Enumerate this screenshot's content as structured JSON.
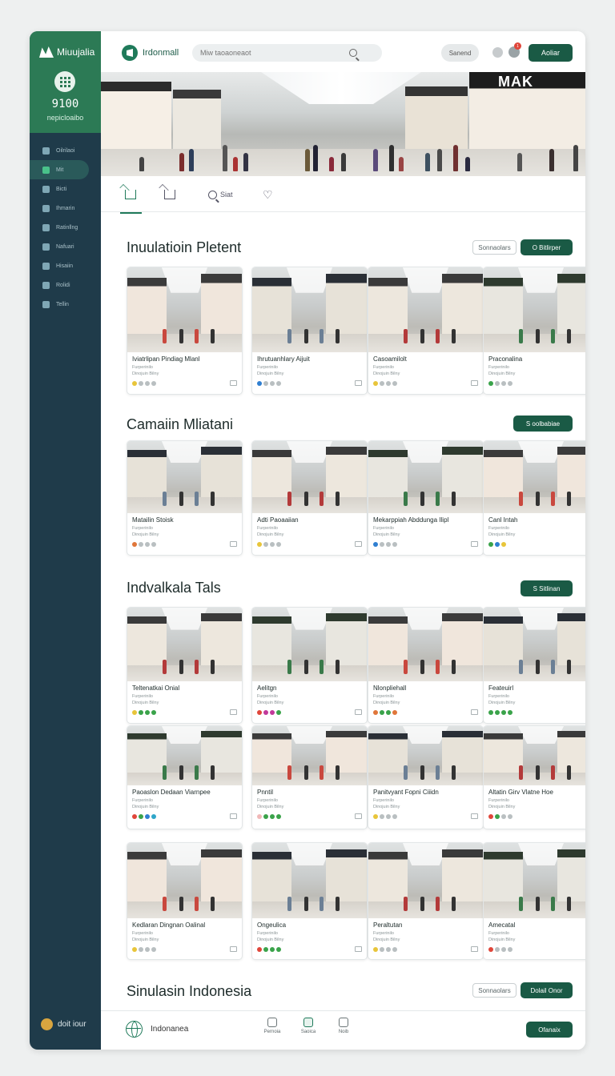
{
  "sidebar": {
    "brand": "Miuujalia",
    "stat_value": "9100",
    "stat_label": "nepicloaibo",
    "items": [
      {
        "label": "Oilrilaoi",
        "active": false
      },
      {
        "label": "Mit",
        "active": true
      },
      {
        "label": "Bicti",
        "active": false
      },
      {
        "label": "Ihmarin",
        "active": false
      },
      {
        "label": "Ratinllng",
        "active": false
      },
      {
        "label": "Nafuari",
        "active": false
      },
      {
        "label": "Hisaiin",
        "active": false
      },
      {
        "label": "Rolidi",
        "active": false
      },
      {
        "label": "Tellin",
        "active": false
      }
    ],
    "footer": "doit iour"
  },
  "header": {
    "logo": "Irdonmall",
    "search_placeholder": "Miw taoaoneaot",
    "secondary_button": "Sanend",
    "badge": "1",
    "primary_button": "Aoliar"
  },
  "hero": {
    "sign": "MAK"
  },
  "tabs": [
    {
      "label": "",
      "icon": "home-icon",
      "active": true
    },
    {
      "label": "",
      "icon": "home-icon",
      "active": false
    },
    {
      "label": "Siat",
      "icon": "search-icon",
      "active": false
    },
    {
      "label": "",
      "icon": "heart-icon",
      "active": false
    }
  ],
  "sections": [
    {
      "title": "Inuulatioin Pletent",
      "outline_button": "Sonnaolars",
      "green_button": "O Bitlirper",
      "cards": [
        {
          "title": "Iviatrlipan Pindiag Mlanl",
          "meta1": "Furperinilo",
          "meta2": "Dinojuin Bilny",
          "dots": [
            "#e8c53a",
            "#b9bfc1",
            "#b9bfc1",
            "#b9bfc1"
          ]
        },
        {
          "title": "Ihrutuanhlary Aijuit",
          "meta1": "Furperinilo",
          "meta2": "Dinojuin Bilny",
          "dots": [
            "#2f7fd1",
            "#b9bfc1",
            "#b9bfc1",
            "#b9bfc1"
          ]
        },
        {
          "title": "Casoamilolt",
          "meta1": "Furperinilo",
          "meta2": "Dinojuin Bilny",
          "dots": [
            "#e8c53a",
            "#b9bfc1",
            "#b9bfc1",
            "#b9bfc1"
          ]
        },
        {
          "title": "Praconalina",
          "meta1": "Furperinilo",
          "meta2": "Dinojuin Bilny",
          "dots": [
            "#3aa34a",
            "#b9bfc1",
            "#b9bfc1",
            "#b9bfc1"
          ]
        }
      ]
    },
    {
      "title": "Camaiin Mliatani",
      "outline_button": "",
      "green_button": "S oolbabiae",
      "cards": [
        {
          "title": "Matailin Stoisk",
          "meta1": "Furperinilo",
          "meta2": "Dinojuin Bilny",
          "dots": [
            "#e0763a",
            "#b9bfc1",
            "#b9bfc1",
            "#b9bfc1"
          ]
        },
        {
          "title": "Adti Paoaaiian",
          "meta1": "Furperinilo",
          "meta2": "Dinojuin Bilny",
          "dots": [
            "#e8c53a",
            "#b9bfc1",
            "#b9bfc1",
            "#b9bfc1"
          ]
        },
        {
          "title": "Mekarppiah Abddunga Ilipl",
          "meta1": "Furperinilo",
          "meta2": "Dinojuin Bilny",
          "dots": [
            "#2f7fd1",
            "#b9bfc1",
            "#b9bfc1",
            "#b9bfc1"
          ]
        },
        {
          "title": "Canl Intah",
          "meta1": "Furperinilo",
          "meta2": "Dinojuin Bilny",
          "dots": [
            "#3aa34a",
            "#2f7fd1",
            "#e8c53a"
          ]
        }
      ]
    },
    {
      "title": "Indvalkala Tals",
      "outline_button": "",
      "green_button": "S Sitlinan",
      "cards": [
        {
          "title": "Teltenatkai Onial",
          "meta1": "Furperinilo",
          "meta2": "Dinojuin Bilny",
          "dots": [
            "#e8c53a",
            "#3aa34a",
            "#3aa34a",
            "#3aa34a"
          ]
        },
        {
          "title": "Aelitgn",
          "meta1": "Furperinilo",
          "meta2": "Dinojuin Bilny",
          "dots": [
            "#e0463a",
            "#c2399a",
            "#c2399a",
            "#3aa34a"
          ]
        },
        {
          "title": "Nlonpliehall",
          "meta1": "Furperinilo",
          "meta2": "Dinojuin Bilny",
          "dots": [
            "#e0763a",
            "#3aa34a",
            "#3aa34a",
            "#e0763a"
          ]
        },
        {
          "title": "Feateuirl",
          "meta1": "Furperinilo",
          "meta2": "Dinojuin Bilny",
          "dots": [
            "#3aa34a",
            "#3aa34a",
            "#3aa34a",
            "#3aa34a"
          ]
        },
        {
          "title": "Paoaslon Dedaan Viarnpee",
          "meta1": "Furperinilo",
          "meta2": "Dinojuin Bilny",
          "dots": [
            "#e0463a",
            "#3aa34a",
            "#2f7fd1",
            "#2fa6c9"
          ]
        },
        {
          "title": "Pnntil",
          "meta1": "Furperinilo",
          "meta2": "Dinojuin Bilny",
          "dots": [
            "#f0b8b8",
            "#3aa34a",
            "#3aa34a",
            "#3aa34a"
          ]
        },
        {
          "title": "Panitvyant Fopni Ciiidn",
          "meta1": "Furperinilo",
          "meta2": "Dinojuin Bilny",
          "dots": [
            "#e8c53a",
            "#b9bfc1",
            "#b9bfc1",
            "#b9bfc1"
          ]
        },
        {
          "title": "Altatin Girv Vlatne Hoe",
          "meta1": "Furperinilo",
          "meta2": "Dinojuin Bilny",
          "dots": [
            "#e0463a",
            "#3aa34a",
            "#b9bfc1",
            "#b9bfc1"
          ]
        },
        {
          "title": "Kedlaran Dingnan Oalinal",
          "meta1": "Furperinilo",
          "meta2": "Dinojuin Bilny",
          "dots": [
            "#e8c53a",
            "#b9bfc1",
            "#b9bfc1",
            "#b9bfc1"
          ]
        },
        {
          "title": "Ongeulica",
          "meta1": "Furperinilo",
          "meta2": "Dinojuin Bilny",
          "dots": [
            "#e0463a",
            "#3aa34a",
            "#3aa34a",
            "#3aa34a"
          ]
        },
        {
          "title": "Peraltutan",
          "meta1": "Furperinilo",
          "meta2": "Dinojuin Bilny",
          "dots": [
            "#e8c53a",
            "#b9bfc1",
            "#b9bfc1",
            "#b9bfc1"
          ]
        },
        {
          "title": "Amecatal",
          "meta1": "Furperinilo",
          "meta2": "Dinojuin Bilny",
          "dots": [
            "#e0463a",
            "#b9bfc1",
            "#b9bfc1",
            "#b9bfc1"
          ]
        }
      ]
    },
    {
      "title": "Sinulasin Indonesia",
      "outline_button": "Sonnaolars",
      "green_button": "Dolail Onor",
      "cards": []
    }
  ],
  "bottombar": {
    "label": "Indonanea",
    "tabs": [
      {
        "label": "Pernoia",
        "active": false
      },
      {
        "label": "Saoica",
        "active": true
      },
      {
        "label": "Noib",
        "active": false
      }
    ],
    "button": "Ofanaix"
  },
  "colors": {
    "primary": "#1a5a45",
    "sidebar": "#1f3b4a",
    "sidebar_top": "#2c7a55",
    "accent": "#1f7a5a"
  }
}
